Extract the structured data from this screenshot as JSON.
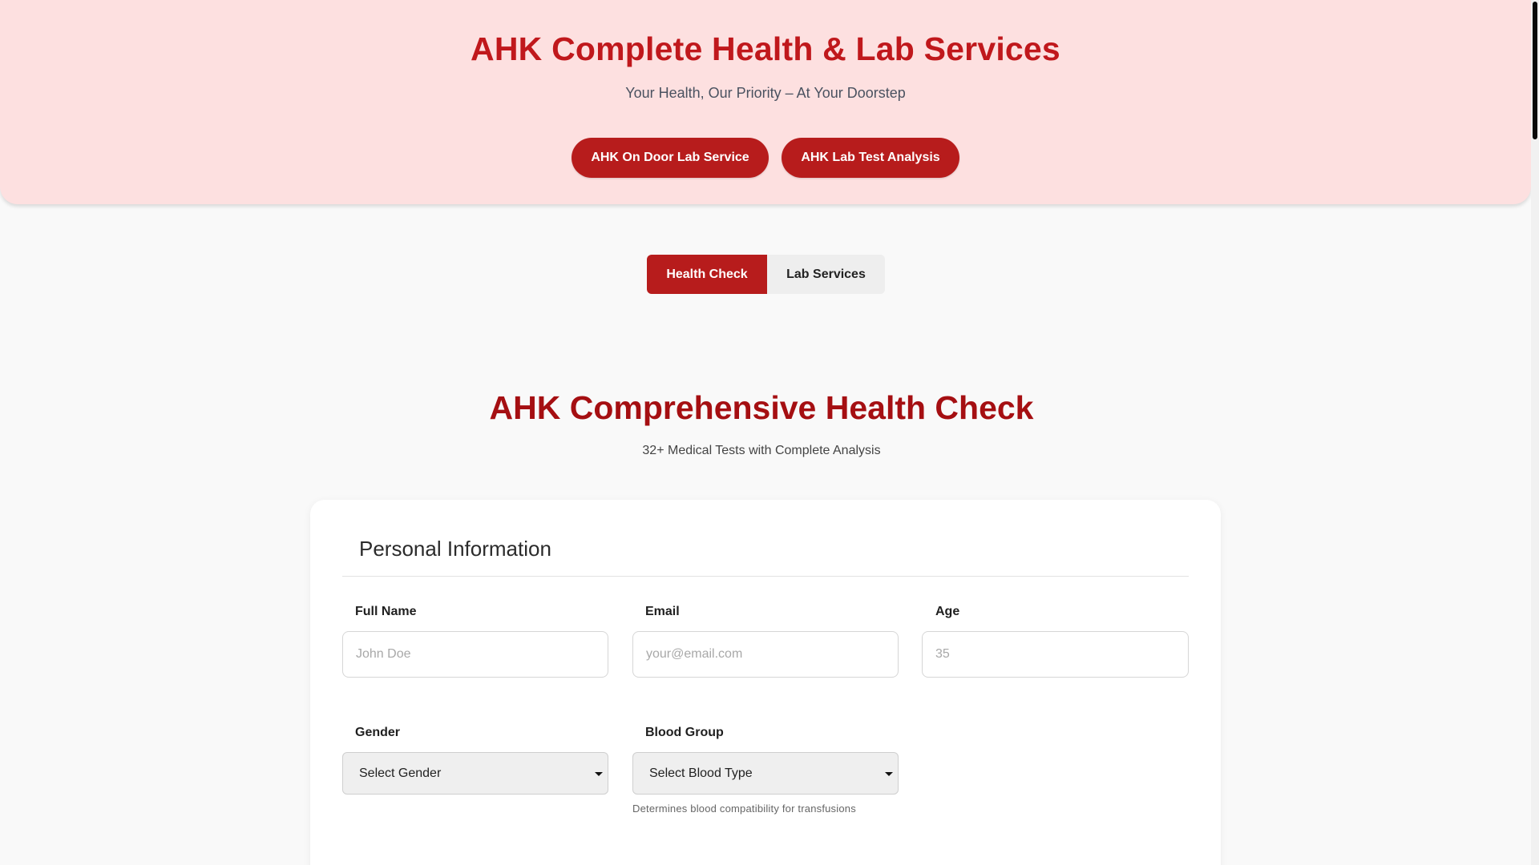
{
  "hero": {
    "title": "AHK Complete Health & Lab Services",
    "subtitle": "Your Health, Our Priority – At Your Doorstep",
    "buttons": [
      {
        "label": "AHK On Door Lab Service"
      },
      {
        "label": "AHK Lab Test Analysis"
      }
    ]
  },
  "tabs": [
    {
      "label": "Health Check",
      "active": true
    },
    {
      "label": "Lab Services",
      "active": false
    }
  ],
  "section": {
    "title": "AHK Comprehensive Health Check",
    "subtitle": "32+ Medical Tests with Complete Analysis"
  },
  "form": {
    "heading": "Personal Information",
    "full_name": {
      "label": "Full Name",
      "placeholder": "John Doe",
      "value": ""
    },
    "email": {
      "label": "Email",
      "placeholder": "your@email.com",
      "value": ""
    },
    "age": {
      "label": "Age",
      "placeholder": "35",
      "value": ""
    },
    "gender": {
      "label": "Gender",
      "selected": "Select Gender"
    },
    "blood_group": {
      "label": "Blood Group",
      "selected": "Select Blood Type",
      "hint": "Determines blood compatibility for transfusions"
    }
  },
  "colors": {
    "brand_red": "#b71c1c",
    "title_red": "#c0181c",
    "hero_background": "#fde0e0"
  }
}
